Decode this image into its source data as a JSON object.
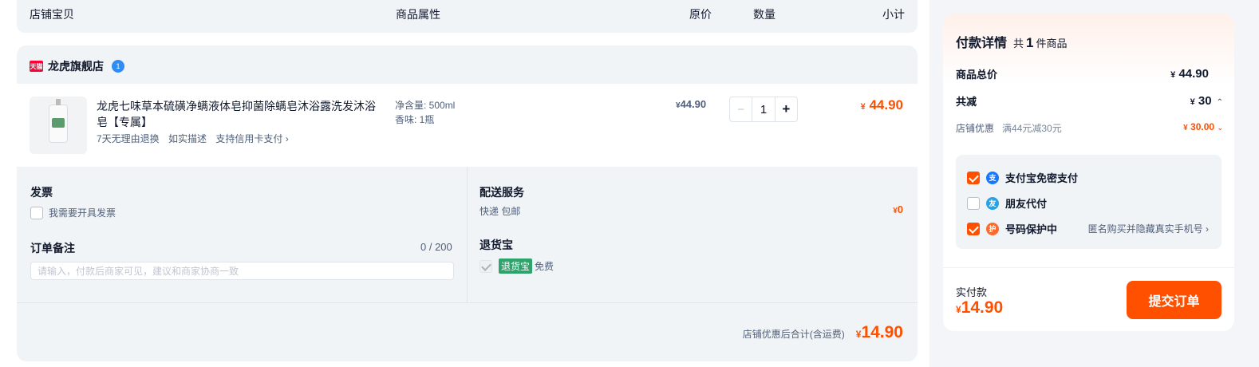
{
  "table_header": {
    "store_item": "店铺宝贝",
    "attributes": "商品属性",
    "original_price": "原价",
    "quantity": "数量",
    "subtotal": "小计"
  },
  "store": {
    "badge": "天猫",
    "name": "龙虎旗舰店",
    "chat_badge": "1"
  },
  "product": {
    "title": "龙虎七味草本硫磺净螨液体皂抑菌除螨皂沐浴露洗发沐浴皂【专属】",
    "tags": [
      "7天无理由退换",
      "如实描述",
      "支持信用卡支付 ›"
    ],
    "attr_net": "净含量: 500ml",
    "attr_scent": "香味: 1瓶",
    "currency": "¥",
    "original_price": "44.90",
    "quantity": "1",
    "qty_minus": "−",
    "qty_plus": "+",
    "subtotal": "44.90"
  },
  "invoice": {
    "title": "发票",
    "checkbox_label": "我需要开具发票"
  },
  "note": {
    "title": "订单备注",
    "count": "0 / 200",
    "placeholder": "请输入，付款后商家可见，建议和商家协商一致",
    "value": ""
  },
  "delivery": {
    "title": "配送服务",
    "text": "快递 包邮",
    "fee": "0"
  },
  "return_service": {
    "title": "退货宝",
    "badge": "退货宝",
    "free": "免费"
  },
  "store_total": {
    "label": "店铺优惠后合计(含运费)",
    "value": "14.90"
  },
  "payment": {
    "title": "付款详情",
    "count_prefix": "共",
    "count": "1",
    "count_suffix": "件商品",
    "total_label": "商品总价",
    "total_value": "44.90",
    "discount_label": "共减",
    "discount_value": "30",
    "store_discount_label": "店铺优惠",
    "store_discount_desc": "满44元减30元",
    "store_discount_value": "30.00",
    "options": [
      {
        "label": "支付宝免密支付",
        "checked": true,
        "icon": "alipay-icon",
        "icon_glyph": "支"
      },
      {
        "label": "朋友代付",
        "checked": false,
        "icon": "friend-pay-icon",
        "icon_glyph": "友"
      },
      {
        "label": "号码保护中",
        "checked": true,
        "icon": "number-protect-icon",
        "icon_glyph": "护"
      }
    ],
    "protect_note": "匿名购买并隐藏真实手机号 ›",
    "actual_label": "实付款",
    "actual_value": "14.90",
    "submit_label": "提交订单"
  },
  "colors": {
    "accent": "#ff5000",
    "alipay": "#1677ff",
    "friend": "#25a3e6",
    "protect": "#ff6a2b",
    "return_badge": "#2ea36b"
  }
}
